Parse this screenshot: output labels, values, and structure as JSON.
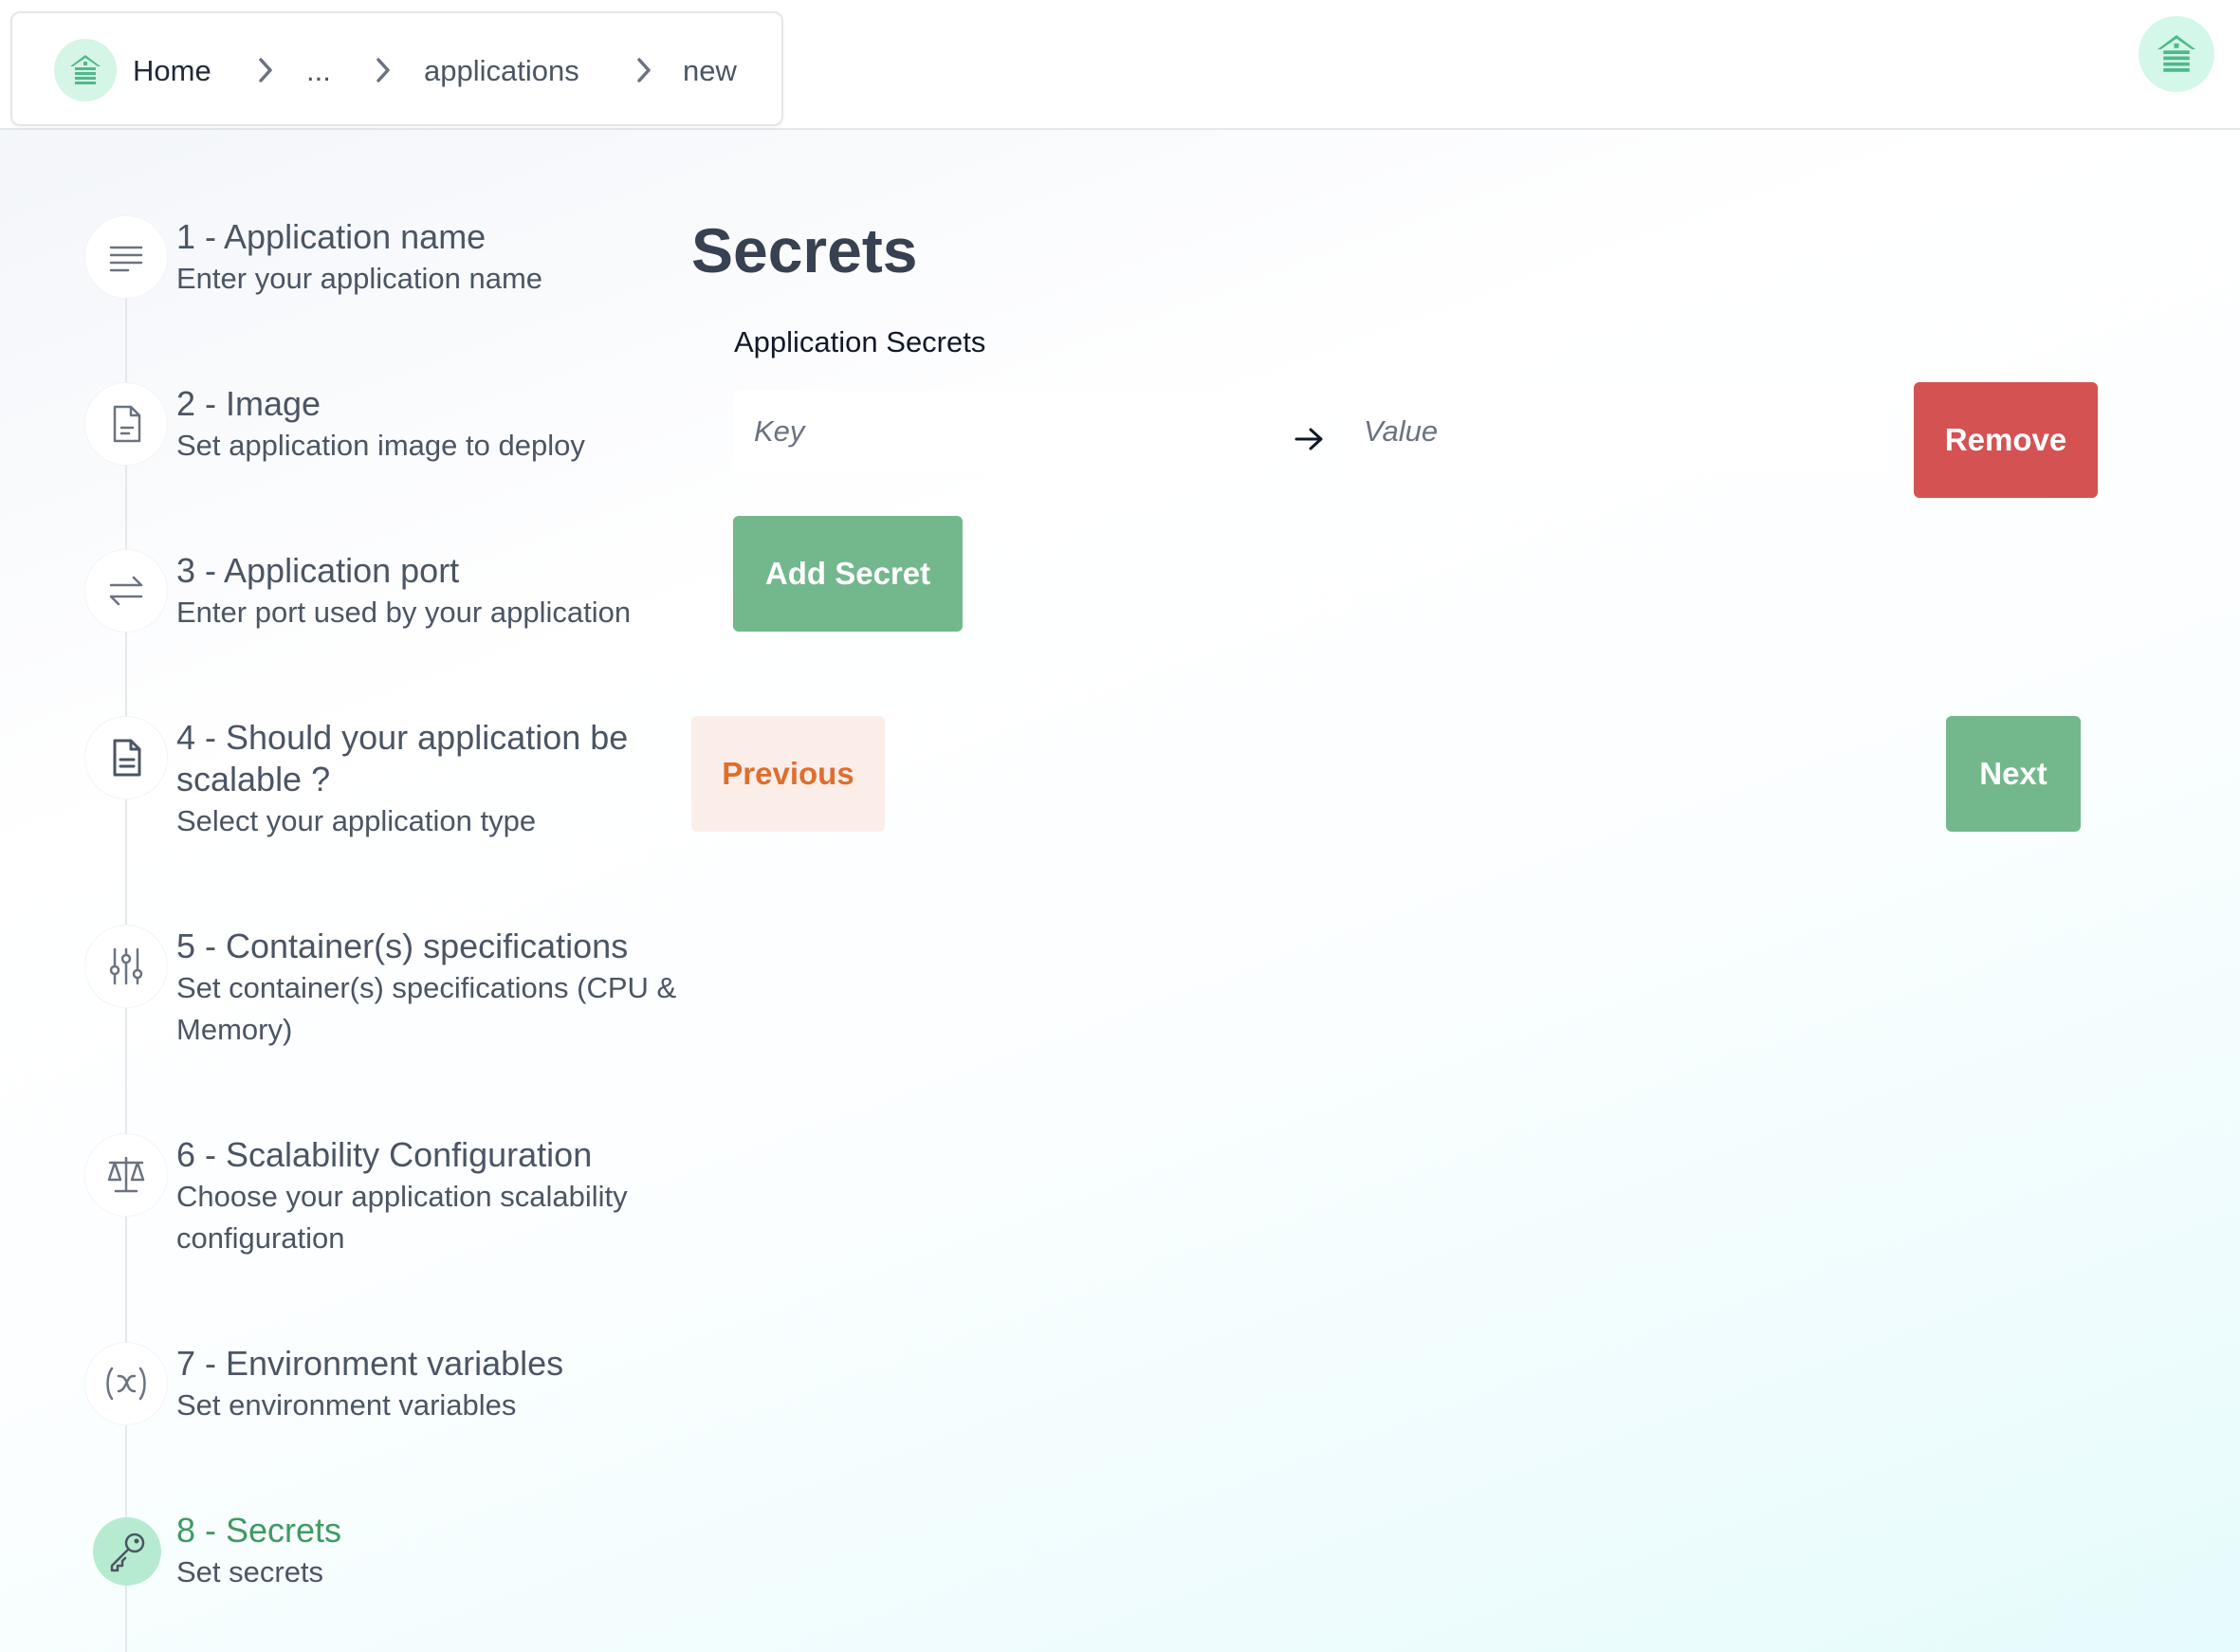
{
  "breadcrumb": {
    "home": "Home",
    "ellipsis": "...",
    "applications": "applications",
    "current": "new"
  },
  "steps": [
    {
      "title": "1 - Application name",
      "desc": "Enter your application name",
      "icon": "text-lines-icon"
    },
    {
      "title": "2 - Image",
      "desc": "Set application image to deploy",
      "icon": "document-icon"
    },
    {
      "title": "3 - Application port",
      "desc": "Enter port used by your application",
      "icon": "arrows-exchange-icon"
    },
    {
      "title": "4 - Should your application be scalable ?",
      "desc": "Select your application type",
      "icon": "file-text-icon"
    },
    {
      "title": "5 - Container(s) specifications",
      "desc": "Set container(s) specifications (CPU & Memory)",
      "icon": "sliders-icon"
    },
    {
      "title": "6 - Scalability Configuration",
      "desc": "Choose your application scalability configuration",
      "icon": "scale-icon"
    },
    {
      "title": "7 - Environment variables",
      "desc": "Set environment variables",
      "icon": "variable-icon"
    },
    {
      "title": "8 - Secrets",
      "desc": "Set secrets",
      "icon": "key-icon"
    }
  ],
  "active_step": 8,
  "main": {
    "title": "Secrets",
    "section_label": "Application Secrets",
    "key_placeholder": "Key",
    "value_placeholder": "Value",
    "remove_label": "Remove",
    "add_label": "Add Secret",
    "previous_label": "Previous",
    "next_label": "Next"
  },
  "colors": {
    "accent_green": "#73b88c",
    "active_step": "#3f9a63",
    "danger": "#d55252",
    "previous_text": "#df6e2e",
    "previous_bg": "#fbeee9"
  }
}
